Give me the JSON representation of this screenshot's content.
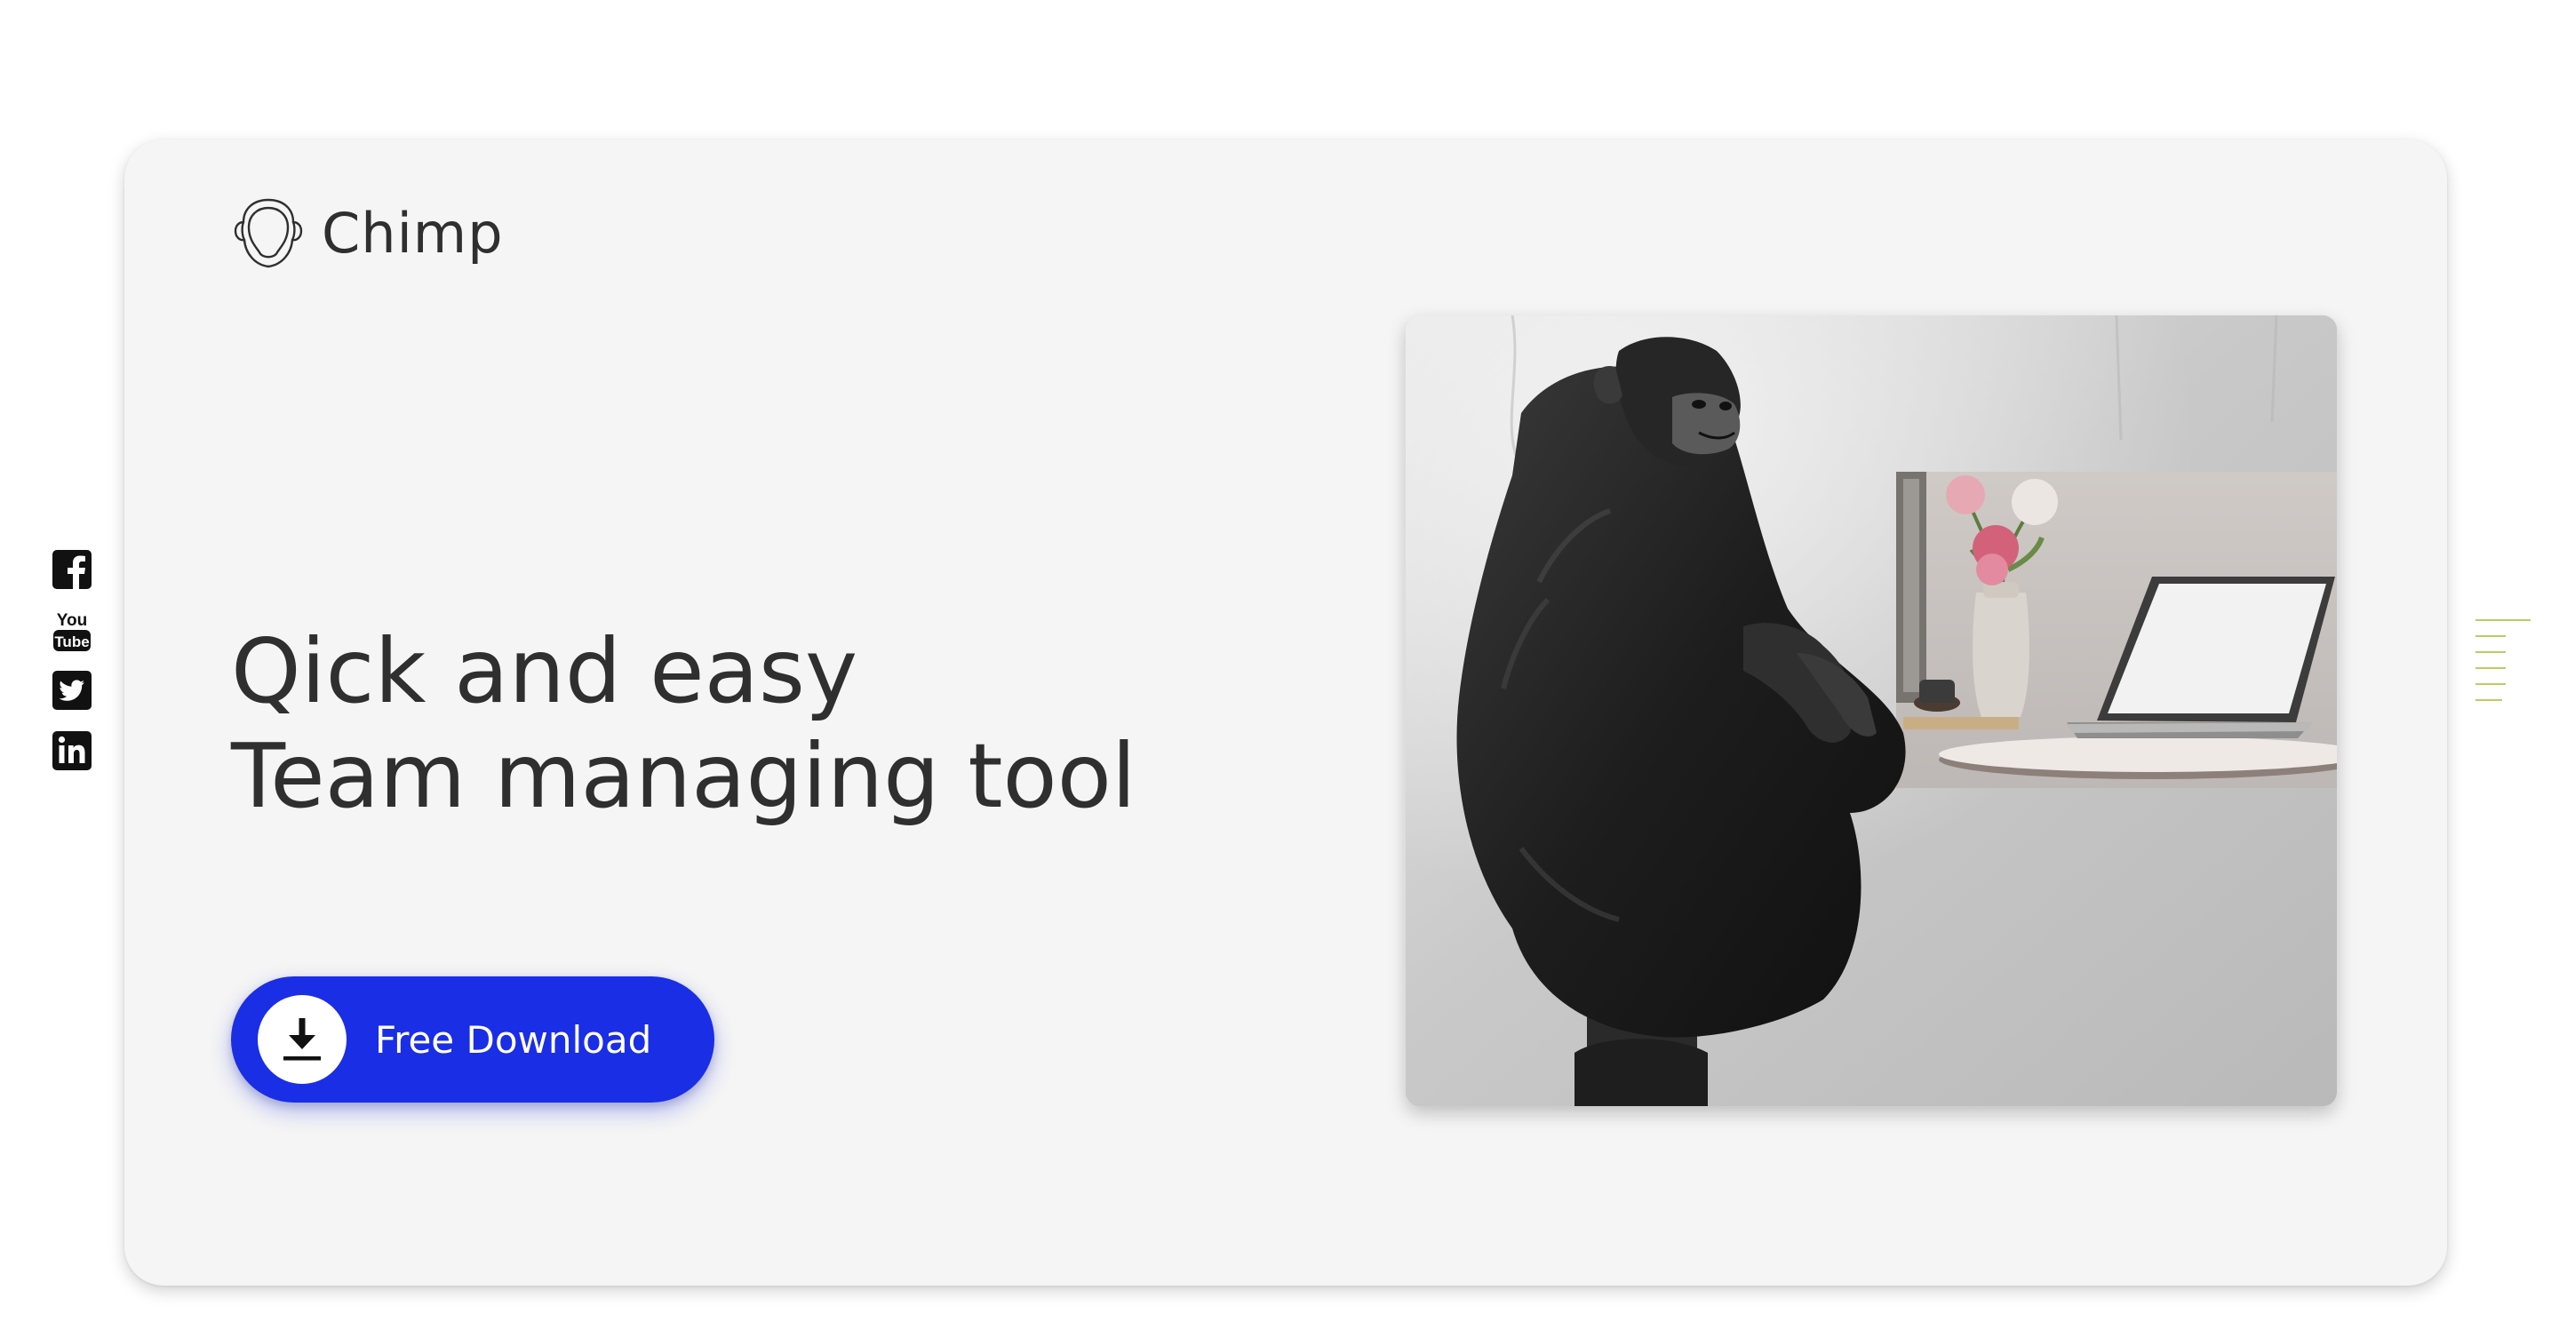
{
  "brand": {
    "name": "Chimp",
    "logo_icon": "chimp-head-outline-icon"
  },
  "hero": {
    "headline_line1": "Qick and easy",
    "headline_line2": "Team managing tool",
    "cta_label": "Free Download",
    "cta_icon": "download-icon",
    "image_subject": "chimpanzee-with-laptop-image"
  },
  "social": {
    "items": [
      {
        "name": "facebook",
        "icon": "facebook-icon"
      },
      {
        "name": "youtube",
        "icon": "youtube-icon",
        "text_top": "You",
        "text_bottom": "Tube"
      },
      {
        "name": "twitter",
        "icon": "twitter-icon"
      },
      {
        "name": "linkedin",
        "icon": "linkedin-icon"
      }
    ]
  },
  "menu": {
    "icon": "menu-lines-icon"
  },
  "colors": {
    "accent": "#1a2ee6",
    "card_background": "#f5f5f5",
    "page_background": "#ffffff",
    "text": "#2f2f2f",
    "menu_lines": "#b7cf63"
  }
}
